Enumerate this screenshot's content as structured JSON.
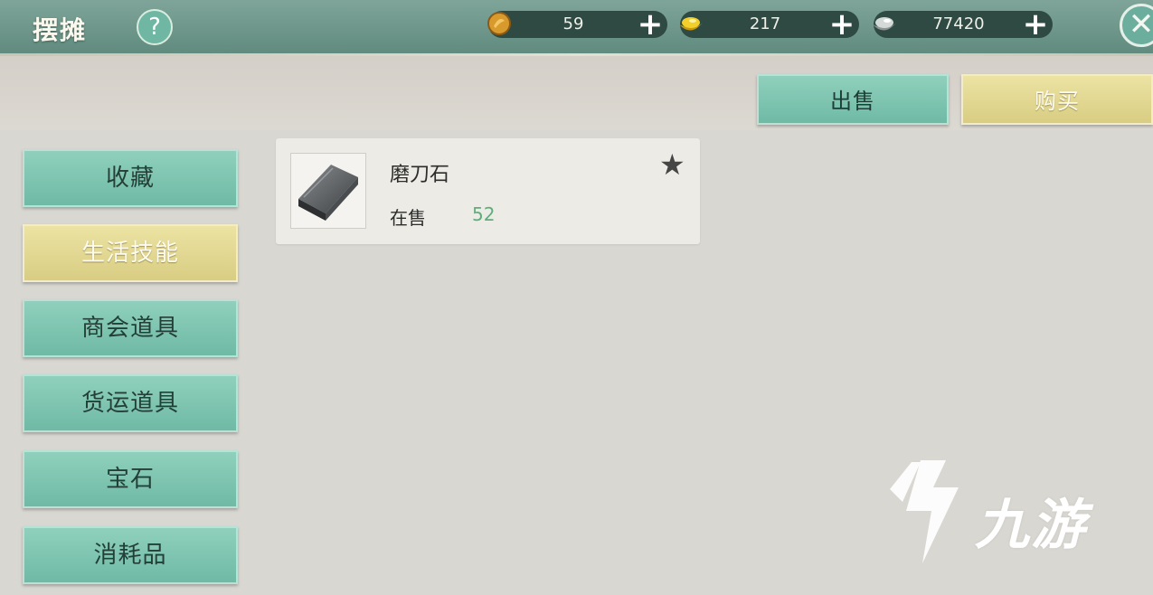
{
  "header": {
    "title": "摆摊",
    "help_label": "?",
    "close_label": "✕",
    "currencies": [
      {
        "icon": "copper-coin-icon",
        "value": "59"
      },
      {
        "icon": "gold-ingot-icon",
        "value": "217"
      },
      {
        "icon": "silver-ingot-icon",
        "value": "77420"
      }
    ],
    "plus_label": "+"
  },
  "mode_tabs": {
    "sell_label": "出售",
    "buy_label": "购买",
    "active": "buy"
  },
  "categories": [
    {
      "label": "收藏",
      "active": false
    },
    {
      "label": "生活技能",
      "active": true
    },
    {
      "label": "商会道具",
      "active": false
    },
    {
      "label": "货运道具",
      "active": false
    },
    {
      "label": "宝石",
      "active": false
    },
    {
      "label": "消耗品",
      "active": false
    }
  ],
  "items": [
    {
      "name": "磨刀石",
      "status_label": "在售",
      "count": "52",
      "favorite_icon": "star-icon"
    }
  ],
  "watermark": {
    "text": "九游",
    "logo_icon": "jiuyou-logo-icon"
  },
  "colors": {
    "accent_green": "#6fbaa5",
    "accent_yellow": "#d9cd83",
    "count_green": "#5fae7a"
  }
}
